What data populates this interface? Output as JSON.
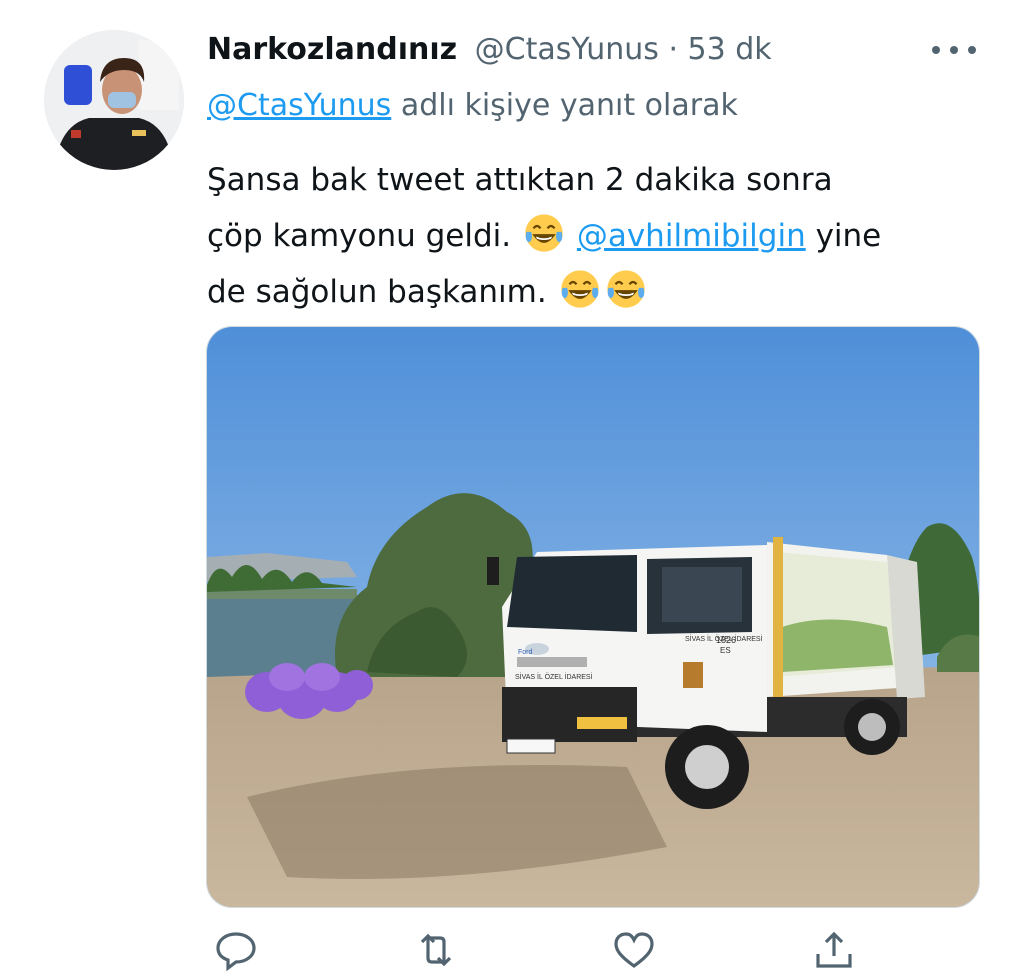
{
  "tweet": {
    "display_name": "Narkozlandınız",
    "handle": "@CtasYunus",
    "separator": " · ",
    "time": "53 dk",
    "reply_to_handle": "@CtasYunus",
    "reply_suffix": " adlı kişiye yanıt olarak",
    "text_line1": "Şansa bak tweet attıktan 2 dakika sonra",
    "text_line2_before": "çöp kamyonu geldi.",
    "mention": "@avhilmibilgin",
    "text_line2_after": " yine",
    "text_line3": "de sağolun başkanım.",
    "emoji_name": "face-with-tears-of-joy"
  },
  "media": {
    "truck_door_text": "SİVAS İL ÖZEL İDARESİ",
    "truck_grille_text": "SİVAS İL ÖZEL İDARESİ",
    "truck_model_text": "1826",
    "truck_model_sub": "ES",
    "truck_brand": "Ford"
  },
  "actions": [
    {
      "name": "reply-icon"
    },
    {
      "name": "retweet-icon"
    },
    {
      "name": "like-icon"
    },
    {
      "name": "share-icon"
    }
  ],
  "colors": {
    "link": "#1d9bf0",
    "secondary_text": "#536471",
    "primary_text": "#0f1419"
  }
}
